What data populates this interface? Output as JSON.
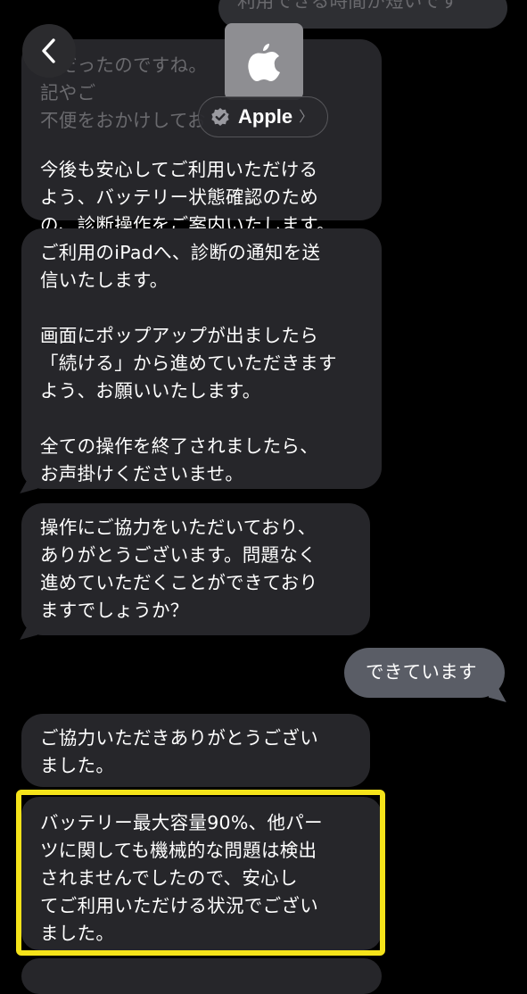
{
  "header": {
    "contact_name": "Apple",
    "avatar_icon": "apple-logo-icon",
    "verified_icon": "verified-badge-icon",
    "back_icon": "chevron-left-icon"
  },
  "messages": [
    {
      "direction": "outgoing",
      "faded": true,
      "paragraphs": [
        "利用できる時間が短いです"
      ]
    },
    {
      "direction": "incoming",
      "paragraphs": [
        "　だったのですね。　　　　　　　　記やご\n不便をおかけしてお",
        "今後も安心してご利用いただける\nよう、バッテリー状態確認のため\nの、診断操作をご案内いたします。"
      ]
    },
    {
      "direction": "incoming",
      "paragraphs": [
        "ご利用のiPadへ、診断の通知を送\n信いたします。",
        "画面にポップアップが出ましたら\n「続ける」から進めていただきます\nよう、お願いいたします。",
        "全ての操作を終了されましたら、\nお声掛けくださいませ。"
      ]
    },
    {
      "direction": "incoming",
      "paragraphs": [
        "操作にご協力をいただいており、\nありがとうございます。問題なく\n進めていただくことができており\nますでしょうか？"
      ]
    },
    {
      "direction": "outgoing",
      "paragraphs": [
        "できています"
      ]
    },
    {
      "direction": "incoming",
      "paragraphs": [
        "ご協力いただきありがとうござい\nました。"
      ]
    },
    {
      "direction": "incoming",
      "highlighted": true,
      "paragraphs": [
        "バッテリー最大容量90%、他パー\nツに関しても機械的な問題は検出\nされませんでしたので、安心し\nてご利用いただける状況でござい\nました。"
      ]
    }
  ],
  "colors": {
    "background": "#000000",
    "incoming_bubble": "#26262a",
    "outgoing_bubble": "#5a5d66",
    "highlight_border": "#f5e31a",
    "avatar": "#8e8e92"
  }
}
